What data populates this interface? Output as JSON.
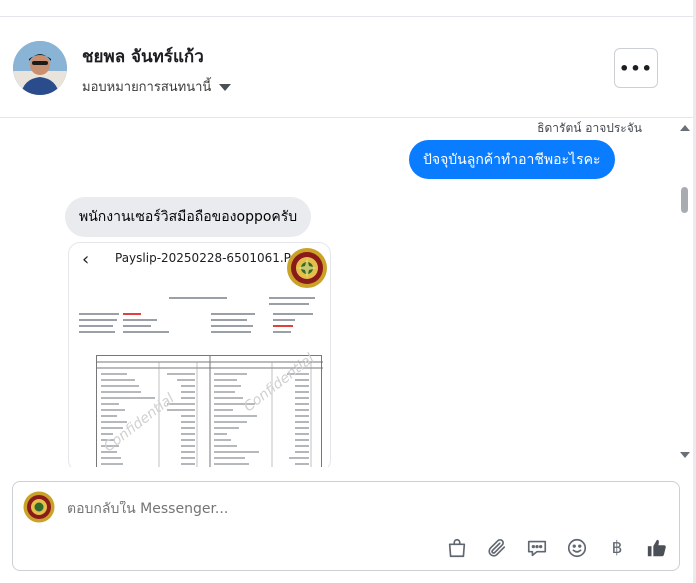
{
  "header": {
    "contact_name": "ชยพล จันทร์แก้ว",
    "assign_label": "มอบหมายการสนทนานี้",
    "more_label": "•••"
  },
  "thread": {
    "sender_name": "ธิดารัตน์ อาจประจัน",
    "outgoing_message": "ปัจจุบันลูกค้าทำอาชีพอะไรคะ",
    "incoming_message": "พนักงานเซอร์วิสมือถือของoppoครับ",
    "attachment": {
      "back_glyph": "‹",
      "title": "Payslip-20250228-6501061.Pdf",
      "watermark": "Confidential"
    }
  },
  "composer": {
    "placeholder": "ตอบกลับใน Messenger...",
    "baht_glyph": "฿"
  },
  "colors": {
    "accent": "#0a7cff",
    "incoming_bubble": "#e9ebee"
  },
  "icons": [
    "chevron-down-icon",
    "more-icon",
    "shopping-bag-icon",
    "paperclip-icon",
    "chat-bubble-icon",
    "emoji-icon",
    "baht-icon",
    "thumbs-up-icon"
  ]
}
